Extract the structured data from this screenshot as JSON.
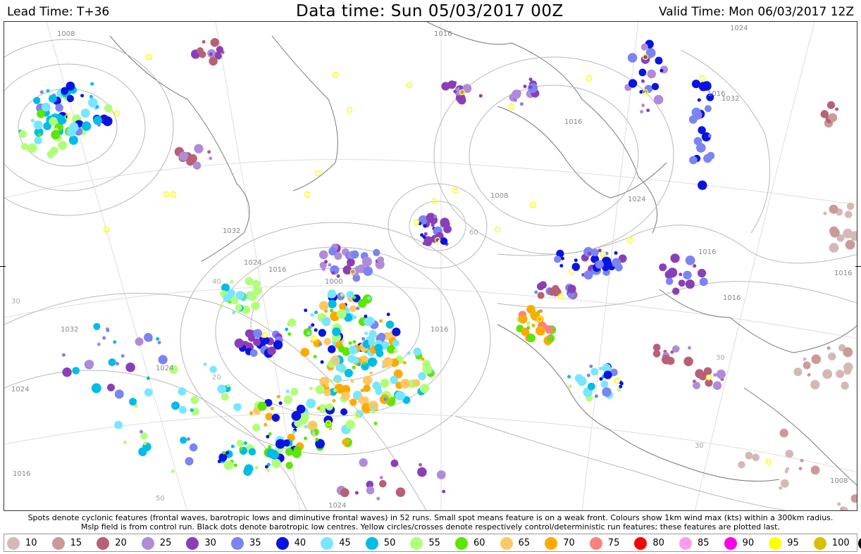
{
  "header": {
    "lead_time": "Lead Time: T+36",
    "data_time": "Data time:  Sun 05/03/2017 00Z",
    "valid_time": "Valid Time: Mon 06/03/2017 12Z"
  },
  "footer": {
    "line1": "Spots denote cyclonic features (frontal waves, barotropic lows and diminutive frontal waves) in 52 runs. Small spot means feature is on a weak front. Colours show 1km wind max (kts) within a 300km radius.",
    "line2": "Mslp field is from control run. Black dots denote barotropic low centres. Yellow circles/crosses denote respectively control/deterministic run features; these features are plotted last."
  },
  "legend": [
    {
      "label": "10",
      "color": "#d4b8b8"
    },
    {
      "label": "15",
      "color": "#cc9999"
    },
    {
      "label": "20",
      "color": "#b86078"
    },
    {
      "label": "25",
      "color": "#b08cd8"
    },
    {
      "label": "30",
      "color": "#8a3fb8"
    },
    {
      "label": "35",
      "color": "#7b84f2"
    },
    {
      "label": "40",
      "color": "#0a14e0"
    },
    {
      "label": "45",
      "color": "#78e6ff"
    },
    {
      "label": "50",
      "color": "#00bce8"
    },
    {
      "label": "55",
      "color": "#b0ff78"
    },
    {
      "label": "60",
      "color": "#5ce600"
    },
    {
      "label": "65",
      "color": "#ffc864"
    },
    {
      "label": "70",
      "color": "#ffaa00"
    },
    {
      "label": "75",
      "color": "#ff8080"
    },
    {
      "label": "80",
      "color": "#ff0000"
    },
    {
      "label": "85",
      "color": "#ff9cf0"
    },
    {
      "label": "90",
      "color": "#ff00e6"
    },
    {
      "label": "95",
      "color": "#ffff00"
    },
    {
      "label": "100",
      "color": "#d8c000"
    },
    {
      "label": "",
      "color": "#000000"
    }
  ],
  "isobar_labels": [
    "1008",
    "1016",
    "1024",
    "1032",
    "1024",
    "1016",
    "1000",
    "1016",
    "1032",
    "1024",
    "1024",
    "1016",
    "1008",
    "1016",
    "1024",
    "1016",
    "1016",
    "1032",
    "1016",
    "1008",
    "1016",
    "1024"
  ],
  "grid_labels": [
    "60",
    "30",
    "20",
    "40",
    "30",
    "50",
    "30"
  ]
}
